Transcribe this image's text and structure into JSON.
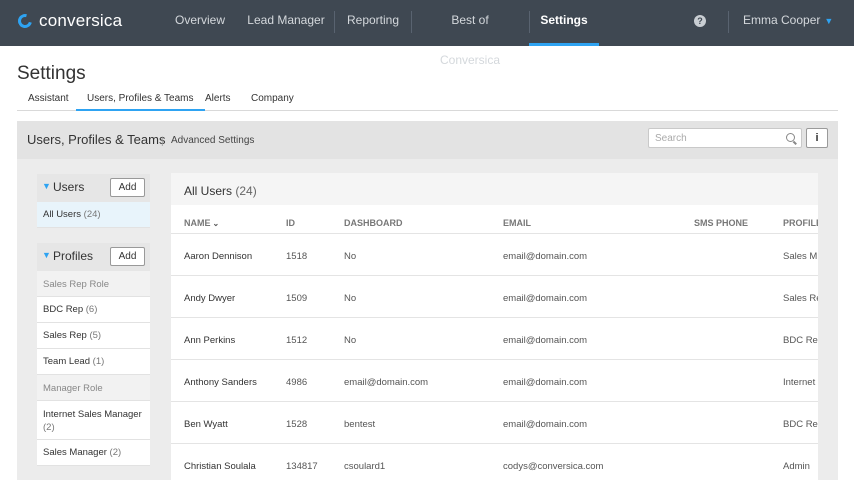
{
  "brand": {
    "name": "conversica"
  },
  "nav": {
    "items": [
      {
        "label": "Overview",
        "active": false
      },
      {
        "label": "Lead Manager",
        "active": false
      },
      {
        "label": "Reporting",
        "active": false
      },
      {
        "label": "Best of Conversica",
        "active": false
      },
      {
        "label": "Settings",
        "active": true
      }
    ],
    "help_icon": "question-circle-icon",
    "help_glyph": "?",
    "user_name": "Emma Cooper"
  },
  "page": {
    "title": "Settings",
    "tabs": [
      {
        "label": "Assistant",
        "active": false
      },
      {
        "label": "Users, Profiles & Teams",
        "active": true
      },
      {
        "label": "Alerts",
        "active": false
      },
      {
        "label": "Company",
        "active": false
      }
    ]
  },
  "content_bar": {
    "title": "Users, Profiles & Teams",
    "separator": "|",
    "advanced_link": "Advanced Settings",
    "search_placeholder": "Search",
    "info_glyph": "i"
  },
  "sidebar": {
    "users": {
      "label": "Users",
      "add_label": "Add",
      "items": [
        {
          "label": "All Users",
          "count": "(24)",
          "active": true
        }
      ]
    },
    "profiles": {
      "label": "Profiles",
      "add_label": "Add",
      "groups": [
        {
          "name": "Sales Rep Role",
          "items": [
            {
              "label": "BDC Rep",
              "count": "(6)"
            },
            {
              "label": "Sales Rep",
              "count": "(5)"
            },
            {
              "label": "Team Lead",
              "count": "(1)"
            }
          ]
        },
        {
          "name": "Manager Role",
          "items": [
            {
              "label": "Internet Sales Manager",
              "count": "(2)"
            },
            {
              "label": "Sales Manager",
              "count": "(2)"
            }
          ]
        }
      ]
    }
  },
  "table": {
    "title": "All Users",
    "count": "(24)",
    "columns": [
      "NAME",
      "ID",
      "DASHBOARD",
      "EMAIL",
      "SMS PHONE",
      "PROFILE"
    ],
    "rows": [
      {
        "name": "Aaron Dennison",
        "id": "1518",
        "dashboard": "No",
        "email": "email@domain.com",
        "sms_phone": "",
        "profile": "Sales M"
      },
      {
        "name": "Andy Dwyer",
        "id": "1509",
        "dashboard": "No",
        "email": "email@domain.com",
        "sms_phone": "",
        "profile": "Sales Re"
      },
      {
        "name": "Ann Perkins",
        "id": "1512",
        "dashboard": "No",
        "email": "email@domain.com",
        "sms_phone": "",
        "profile": "BDC Rep"
      },
      {
        "name": "Anthony Sanders",
        "id": "4986",
        "dashboard": "email@domain.com",
        "email": "email@domain.com",
        "sms_phone": "",
        "profile": "Internet"
      },
      {
        "name": "Ben Wyatt",
        "id": "1528",
        "dashboard": "bentest",
        "email": "email@domain.com",
        "sms_phone": "",
        "profile": "BDC Rep"
      },
      {
        "name": "Christian Soulala",
        "id": "134817",
        "dashboard": "csoulard1",
        "email": "codys@conversica.com",
        "sms_phone": "",
        "profile": "Admin"
      }
    ]
  },
  "colors": {
    "nav_bg": "#3f4852",
    "accent": "#2ea3f2"
  }
}
